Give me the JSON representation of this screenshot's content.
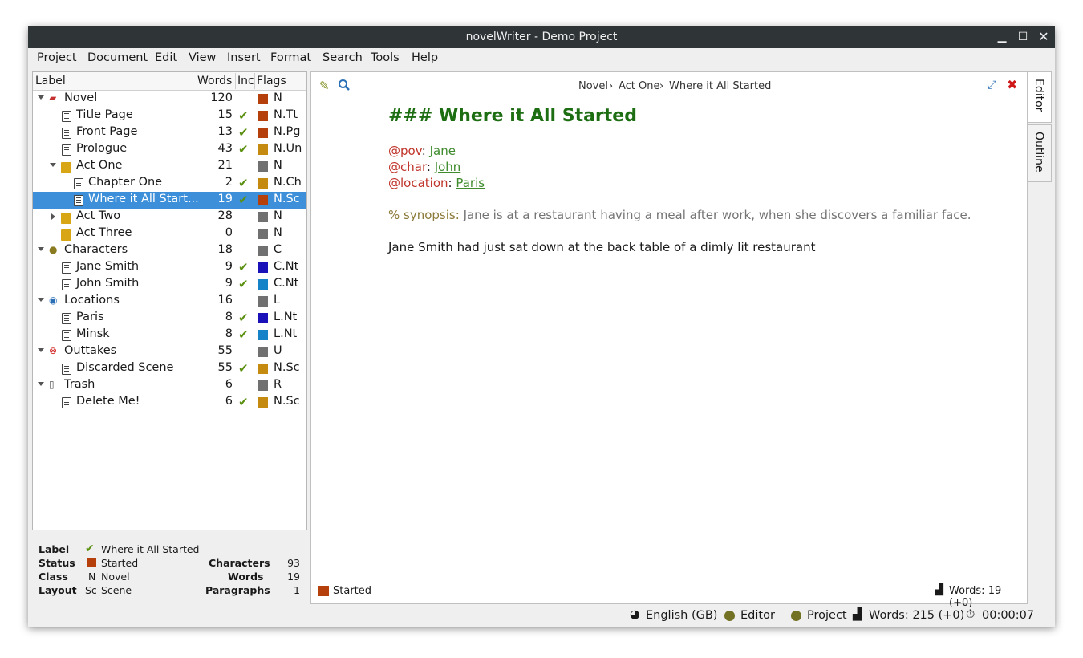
{
  "window": {
    "title": "novelWriter - Demo Project"
  },
  "menu": [
    "Project",
    "Document",
    "Edit",
    "View",
    "Insert",
    "Format",
    "Search",
    "Tools",
    "Help"
  ],
  "tree": {
    "headers": {
      "label": "Label",
      "words": "Words",
      "inc": "Inc",
      "flags": "Flags"
    },
    "rows": [
      {
        "label": "Novel",
        "words": "120",
        "inc": "",
        "flag": "N",
        "color": "#b5400b",
        "indent": 0,
        "arrow": "down",
        "icon": "novel-root-icon"
      },
      {
        "label": "Title Page",
        "words": "15",
        "inc": "✔",
        "flag": "N.Tt",
        "color": "#b5400b",
        "indent": 1,
        "arrow": "",
        "icon": "document-icon"
      },
      {
        "label": "Front Page",
        "words": "13",
        "inc": "✔",
        "flag": "N.Pg",
        "color": "#b5400b",
        "indent": 1,
        "arrow": "",
        "icon": "document-icon"
      },
      {
        "label": "Prologue",
        "words": "43",
        "inc": "✔",
        "flag": "N.Un",
        "color": "#c58a10",
        "indent": 1,
        "arrow": "",
        "icon": "document-icon"
      },
      {
        "label": "Act One",
        "words": "21",
        "inc": "",
        "flag": "N",
        "color": "#707070",
        "indent": 1,
        "arrow": "down",
        "icon": "folder-icon"
      },
      {
        "label": "Chapter One",
        "words": "2",
        "inc": "✔",
        "flag": "N.Ch",
        "color": "#c58a10",
        "indent": 2,
        "arrow": "",
        "icon": "document-icon"
      },
      {
        "label": "Where it All Start...",
        "words": "19",
        "inc": "✔",
        "flag": "N.Sc",
        "color": "#b5400b",
        "indent": 2,
        "arrow": "",
        "icon": "document-icon",
        "selected": true
      },
      {
        "label": "Act Two",
        "words": "28",
        "inc": "",
        "flag": "N",
        "color": "#707070",
        "indent": 1,
        "arrow": "right",
        "icon": "folder-icon"
      },
      {
        "label": "Act Three",
        "words": "0",
        "inc": "",
        "flag": "N",
        "color": "#707070",
        "indent": 1,
        "arrow": "",
        "icon": "folder-icon"
      },
      {
        "label": "Characters",
        "words": "18",
        "inc": "",
        "flag": "C",
        "color": "#707070",
        "indent": 0,
        "arrow": "down",
        "icon": "person-icon"
      },
      {
        "label": "Jane Smith",
        "words": "9",
        "inc": "✔",
        "flag": "C.Nt",
        "color": "#1a12b8",
        "indent": 1,
        "arrow": "",
        "icon": "document-icon"
      },
      {
        "label": "John Smith",
        "words": "9",
        "inc": "✔",
        "flag": "C.Nt",
        "color": "#1682c8",
        "indent": 1,
        "arrow": "",
        "icon": "document-icon"
      },
      {
        "label": "Locations",
        "words": "16",
        "inc": "",
        "flag": "L",
        "color": "#707070",
        "indent": 0,
        "arrow": "down",
        "icon": "location-pin-icon"
      },
      {
        "label": "Paris",
        "words": "8",
        "inc": "✔",
        "flag": "L.Nt",
        "color": "#1a12b8",
        "indent": 1,
        "arrow": "",
        "icon": "document-icon"
      },
      {
        "label": "Minsk",
        "words": "8",
        "inc": "✔",
        "flag": "L.Nt",
        "color": "#1682c8",
        "indent": 1,
        "arrow": "",
        "icon": "document-icon"
      },
      {
        "label": "Outtakes",
        "words": "55",
        "inc": "",
        "flag": "U",
        "color": "#707070",
        "indent": 0,
        "arrow": "down",
        "icon": "outtakes-icon"
      },
      {
        "label": "Discarded Scene",
        "words": "55",
        "inc": "✔",
        "flag": "N.Sc",
        "color": "#c58a10",
        "indent": 1,
        "arrow": "",
        "icon": "document-icon"
      },
      {
        "label": "Trash",
        "words": "6",
        "inc": "",
        "flag": "R",
        "color": "#707070",
        "indent": 0,
        "arrow": "down",
        "icon": "trash-icon"
      },
      {
        "label": "Delete Me!",
        "words": "6",
        "inc": "✔",
        "flag": "N.Sc",
        "color": "#c58a10",
        "indent": 1,
        "arrow": "",
        "icon": "document-icon"
      }
    ]
  },
  "details": {
    "label_key": "Label",
    "label_val": "Where it All Started",
    "status_key": "Status",
    "status_val": "Started",
    "class_key": "Class",
    "class_code": "N",
    "class_val": "Novel",
    "layout_key": "Layout",
    "layout_code": "Sc",
    "layout_val": "Scene",
    "chars_key": "Characters",
    "chars_val": "93",
    "words_key": "Words",
    "words_val": "19",
    "paras_key": "Paragraphs",
    "paras_val": "1"
  },
  "editor": {
    "breadcrumb": [
      "Novel",
      "Act One",
      "Where it All Started"
    ],
    "heading": "### Where it All Started",
    "pov_kw": "@pov",
    "pov_val": "Jane",
    "char_kw": "@char",
    "char_val": "John",
    "loc_kw": "@location",
    "loc_val": "Paris",
    "synopsis_kw": "% synopsis:",
    "synopsis_text": "Jane is at a restaurant having a meal after work, when she discovers a familiar face.",
    "body": "Jane Smith had just sat down at the back table of a dimly lit restaurant",
    "footer_status": "Started",
    "footer_words": "Words: 19 (+0)"
  },
  "sidetabs": {
    "editor": "Editor",
    "outline": "Outline"
  },
  "statusbar": {
    "language": "English (GB)",
    "editor": "Editor",
    "project": "Project",
    "words": "Words: 215 (+0)",
    "time": "00:00:07"
  }
}
